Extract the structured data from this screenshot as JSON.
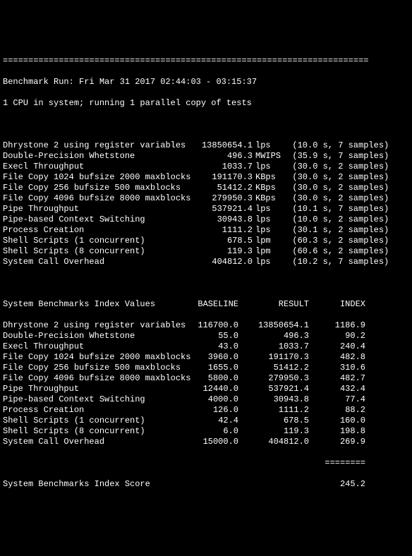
{
  "separator": "========================================================================",
  "run_line": "Benchmark Run: Fri Mar 31 2017 02:44:03 - 03:15:37",
  "cpu_line": "1 CPU in system; running 1 parallel copy of tests",
  "tests": [
    {
      "name": "Dhrystone 2 using register variables",
      "value": "13850654.1",
      "unit": "lps",
      "time": "(10.0 s,",
      "samples": "7 samples)"
    },
    {
      "name": "Double-Precision Whetstone",
      "value": "496.3",
      "unit": "MWIPS",
      "time": "(35.9 s,",
      "samples": "7 samples)"
    },
    {
      "name": "Execl Throughput",
      "value": "1033.7",
      "unit": "lps",
      "time": "(30.0 s,",
      "samples": "2 samples)"
    },
    {
      "name": "File Copy 1024 bufsize 2000 maxblocks",
      "value": "191170.3",
      "unit": "KBps",
      "time": "(30.0 s,",
      "samples": "2 samples)"
    },
    {
      "name": "File Copy 256 bufsize 500 maxblocks",
      "value": "51412.2",
      "unit": "KBps",
      "time": "(30.0 s,",
      "samples": "2 samples)"
    },
    {
      "name": "File Copy 4096 bufsize 8000 maxblocks",
      "value": "279950.3",
      "unit": "KBps",
      "time": "(30.0 s,",
      "samples": "2 samples)"
    },
    {
      "name": "Pipe Throughput",
      "value": "537921.4",
      "unit": "lps",
      "time": "(10.1 s,",
      "samples": "7 samples)"
    },
    {
      "name": "Pipe-based Context Switching",
      "value": "30943.8",
      "unit": "lps",
      "time": "(10.0 s,",
      "samples": "2 samples)"
    },
    {
      "name": "Process Creation",
      "value": "1111.2",
      "unit": "lps",
      "time": "(30.1 s,",
      "samples": "2 samples)"
    },
    {
      "name": "Shell Scripts (1 concurrent)",
      "value": "678.5",
      "unit": "lpm",
      "time": "(60.3 s,",
      "samples": "2 samples)"
    },
    {
      "name": "Shell Scripts (8 concurrent)",
      "value": "119.3",
      "unit": "lpm",
      "time": "(60.6 s,",
      "samples": "2 samples)"
    },
    {
      "name": "System Call Overhead",
      "value": "404812.0",
      "unit": "lps",
      "time": "(10.2 s,",
      "samples": "7 samples)"
    }
  ],
  "idx_header": {
    "title": "System Benchmarks Index Values",
    "c1": "BASELINE",
    "c2": "RESULT",
    "c3": "INDEX"
  },
  "indices": [
    {
      "name": "Dhrystone 2 using register variables",
      "baseline": "116700.0",
      "result": "13850654.1",
      "index": "1186.9"
    },
    {
      "name": "Double-Precision Whetstone",
      "baseline": "55.0",
      "result": "496.3",
      "index": "90.2"
    },
    {
      "name": "Execl Throughput",
      "baseline": "43.0",
      "result": "1033.7",
      "index": "240.4"
    },
    {
      "name": "File Copy 1024 bufsize 2000 maxblocks",
      "baseline": "3960.0",
      "result": "191170.3",
      "index": "482.8"
    },
    {
      "name": "File Copy 256 bufsize 500 maxblocks",
      "baseline": "1655.0",
      "result": "51412.2",
      "index": "310.6"
    },
    {
      "name": "File Copy 4096 bufsize 8000 maxblocks",
      "baseline": "5800.0",
      "result": "279950.3",
      "index": "482.7"
    },
    {
      "name": "Pipe Throughput",
      "baseline": "12440.0",
      "result": "537921.4",
      "index": "432.4"
    },
    {
      "name": "Pipe-based Context Switching",
      "baseline": "4000.0",
      "result": "30943.8",
      "index": "77.4"
    },
    {
      "name": "Process Creation",
      "baseline": "126.0",
      "result": "1111.2",
      "index": "88.2"
    },
    {
      "name": "Shell Scripts (1 concurrent)",
      "baseline": "42.4",
      "result": "678.5",
      "index": "160.0"
    },
    {
      "name": "Shell Scripts (8 concurrent)",
      "baseline": "6.0",
      "result": "119.3",
      "index": "198.8"
    },
    {
      "name": "System Call Overhead",
      "baseline": "15000.0",
      "result": "404812.0",
      "index": "269.9"
    }
  ],
  "dashes": "========",
  "score_label": "System Benchmarks Index Score",
  "score_value": "245.2"
}
